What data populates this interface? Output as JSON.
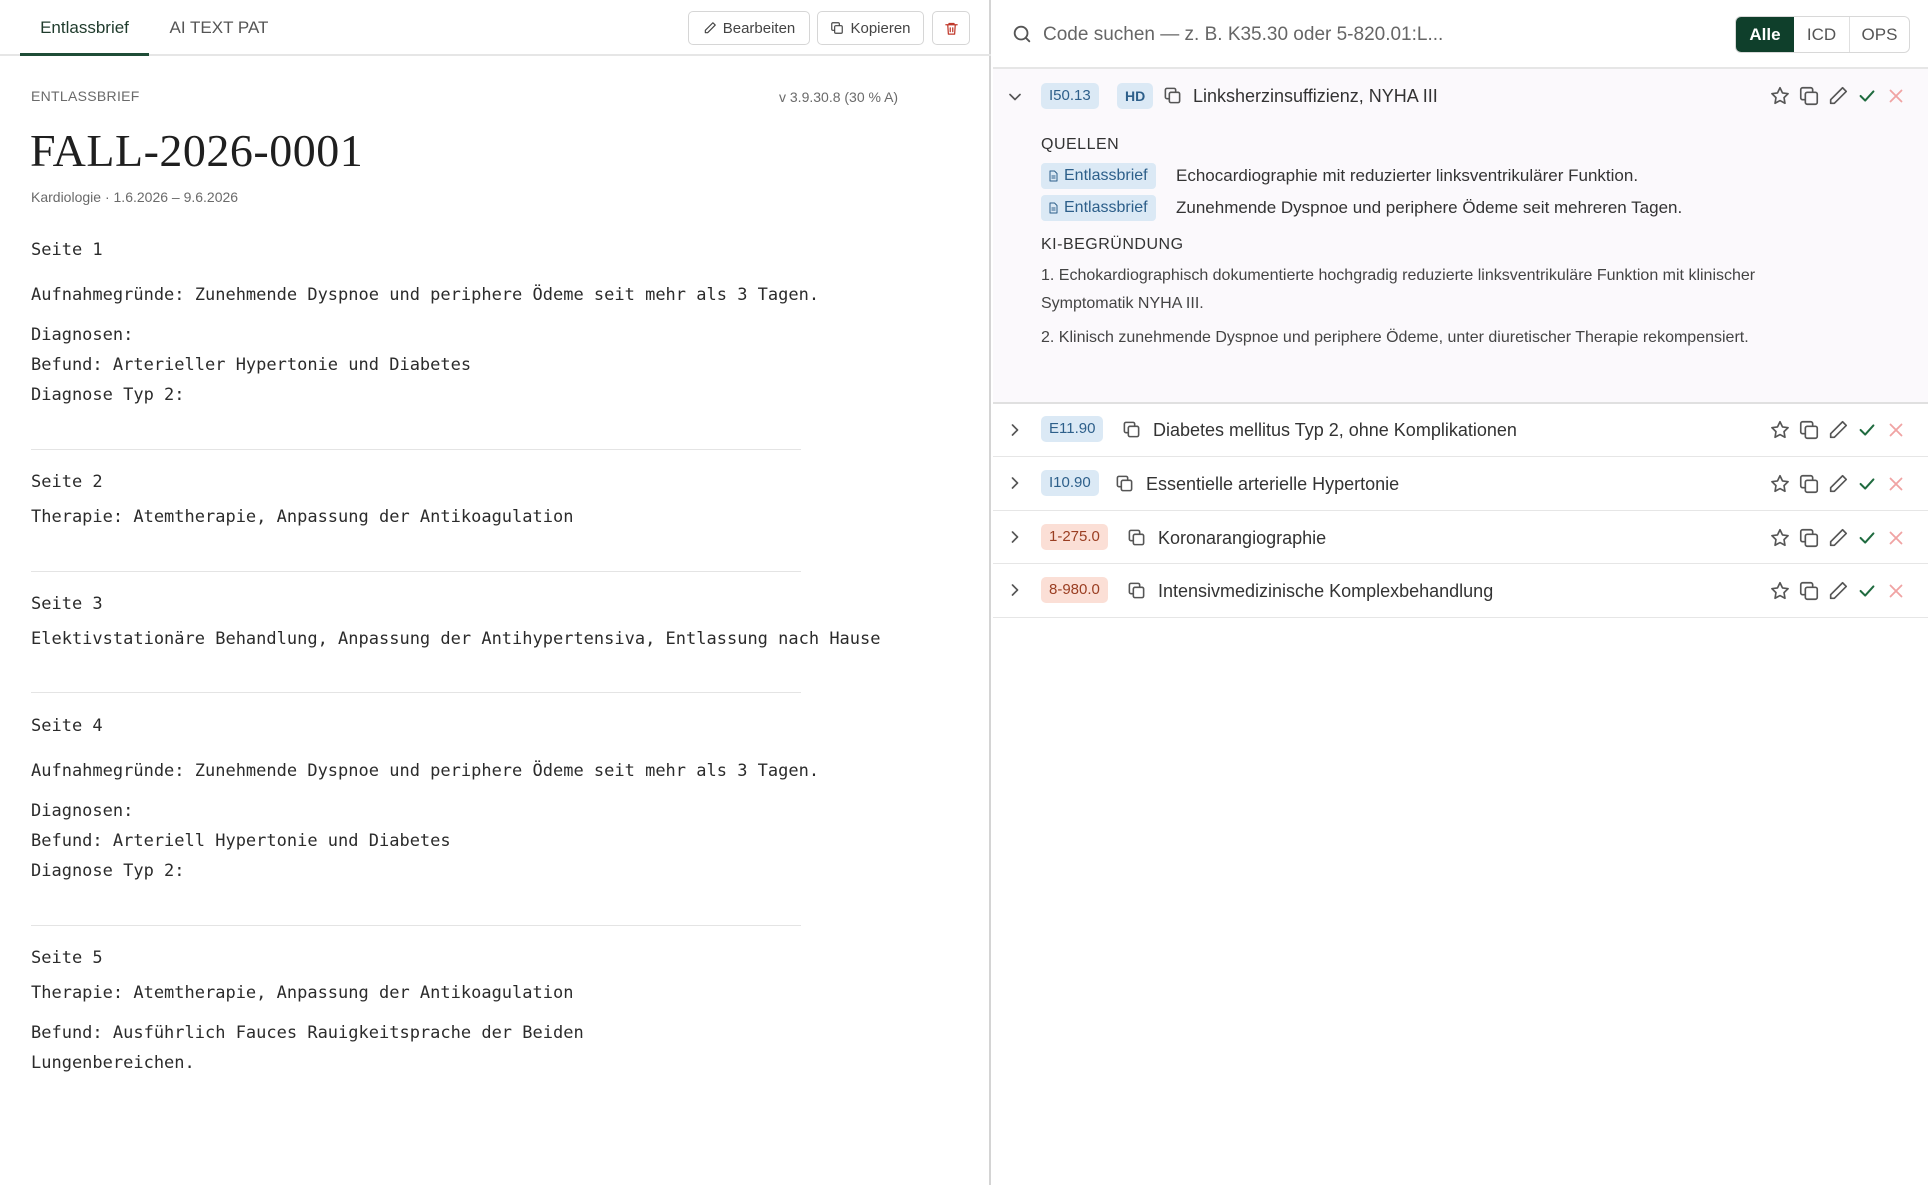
{
  "left": {
    "tabs": [
      "Entlassbrief",
      "AI TEXT PAT"
    ],
    "toolbar": {
      "edit_label": "Bearbeiten",
      "copy_label": "Kopieren"
    },
    "doc_label": "ENTLASSBRIEF",
    "version": "v 3.9.30.8 (30 % A)",
    "title": "FALL-2026-0001",
    "department": "Kardiologie",
    "date_range": "1.6.2026 – 9.6.2026",
    "pages": [
      {
        "heading": "Seite 1",
        "lines": [
          "Aufnahmegründe: Zunehmende Dyspnoe und periphere Ödeme seit mehr als 3 Tagen.",
          "Diagnosen:",
          "Befund: Arterieller Hypertonie und Diabetes",
          "Diagnose Typ 2:"
        ]
      },
      {
        "heading": "Seite 2",
        "lines": [
          "Therapie: Atemtherapie, Anpassung der Antikoagulation"
        ]
      },
      {
        "heading": "Seite 3",
        "lines": [
          "Elektivstationäre Behandlung, Anpassung der Antihypertensiva, Entlassung nach Hause"
        ]
      },
      {
        "heading": "Seite 4",
        "lines": [
          "Aufnahmegründe: Zunehmende Dyspnoe und periphere Ödeme seit mehr als 3 Tagen.",
          "Diagnosen:",
          "Befund: Arteriell Hypertonie und Diabetes",
          "Diagnose Typ 2:"
        ]
      },
      {
        "heading": "Seite 5",
        "lines": [
          "Therapie: Atemtherapie, Anpassung der Antikoagulation",
          "Befund: Ausführlich Fauces Rauigkeitsprache der Beiden",
          "Lungenbereichen."
        ]
      }
    ]
  },
  "right": {
    "search": {
      "placeholder": "Code suchen — z. B. K35.30 oder 5-820.01:L..."
    },
    "filters": [
      "Alle",
      "ICD",
      "OPS"
    ],
    "expanded": {
      "code": "I50.13",
      "badge": "HD",
      "title": "Linksherzinsuffizienz, NYHA III",
      "sources_heading": "QUELLEN",
      "sources": [
        {
          "badge": "Entlassbrief",
          "text": "Echocardiographie mit reduzierter linksventrikulärer Funktion."
        },
        {
          "badge": "Entlassbrief",
          "text": "Zunehmende Dyspnoe und periphere Ödeme seit mehreren Tagen."
        }
      ],
      "reason_heading": "KI-BEGRÜNDUNG",
      "reasons": [
        "1. Echokardiographisch dokumentierte hochgradig reduzierte linksventrikuläre Funktion mit klinischer Symptomatik NYHA III.",
        "2. Klinisch zunehmende Dyspnoe und periphere Ödeme, unter diuretischer Therapie rekompensiert."
      ]
    },
    "codes": [
      {
        "code": "E11.90",
        "kind": "icd",
        "title": "Diabetes mellitus Typ 2, ohne Komplikationen"
      },
      {
        "code": "I10.90",
        "kind": "icd",
        "title": "Essentielle arterielle Hypertonie"
      },
      {
        "code": "1-275.0",
        "kind": "ops",
        "title": "Koronarangiographie"
      },
      {
        "code": "8-980.0",
        "kind": "ops",
        "title": "Intensivmedizinische Komplexbehandlung"
      }
    ]
  }
}
